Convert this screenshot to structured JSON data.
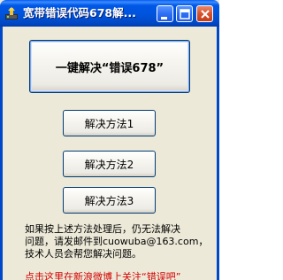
{
  "window": {
    "title": "宽带错误代码678解..."
  },
  "main_button": {
    "label": "一键解决“错误678”"
  },
  "methods": [
    {
      "label": "解决方法1"
    },
    {
      "label": "解决方法2"
    },
    {
      "label": "解决方法3"
    }
  ],
  "info": {
    "lines": [
      "如果按上述方法处理后，仍无法解决",
      "问题，请发邮件到cuowuba@163.com，",
      "技术人员会帮您解决问题。"
    ]
  },
  "notice": {
    "text": "点击这里在新浪微博上关注“错误吧”"
  },
  "colors": {
    "titlebar": "#0054e3",
    "window_bg": "#ece9d8",
    "close_button": "#d7512c",
    "notice_text": "#d40000"
  },
  "icons": [
    "app-icon",
    "minimize-icon",
    "maximize-icon",
    "close-icon"
  ]
}
